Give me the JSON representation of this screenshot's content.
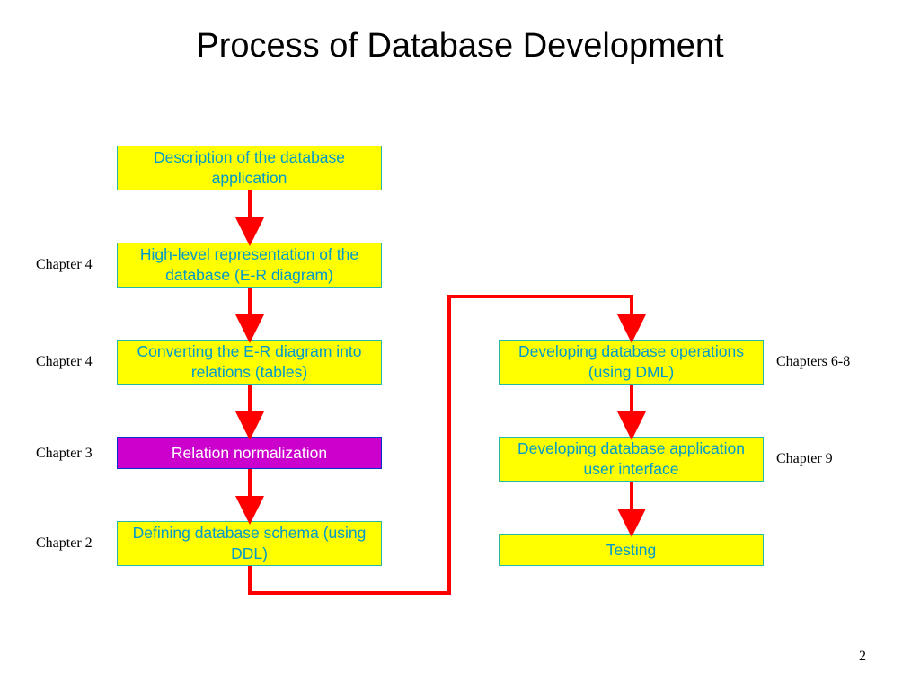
{
  "title": "Process of Database Development",
  "boxes": {
    "description": "Description of the database application",
    "highlevel": "High-level representation of the database (E-R diagram)",
    "converting": "Converting the E-R diagram into relations (tables)",
    "normalization": "Relation normalization",
    "schema": "Defining database schema (using DDL)",
    "operations": "Developing database operations (using DML)",
    "ui": "Developing database application user interface",
    "testing": "Testing"
  },
  "labels": {
    "ch4a": "Chapter 4",
    "ch4b": "Chapter 4",
    "ch3": "Chapter 3",
    "ch2": "Chapter 2",
    "ch68": "Chapters 6-8",
    "ch9": "Chapter 9"
  },
  "page_number": "2"
}
